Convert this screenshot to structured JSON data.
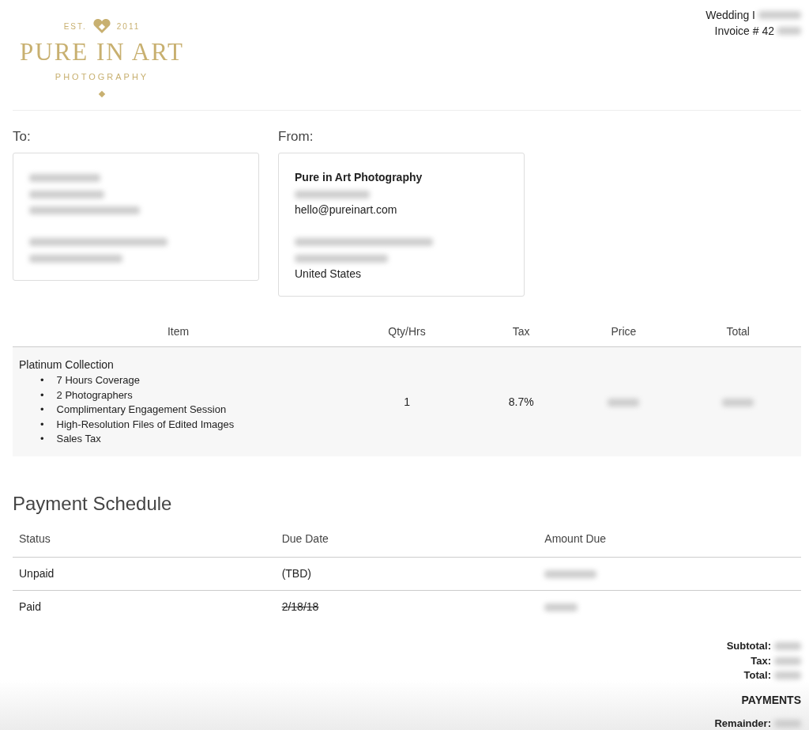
{
  "logo": {
    "est": "EST.",
    "year": "2011",
    "name": "PURE IN ART",
    "tagline": "PHOTOGRAPHY"
  },
  "header": {
    "event": "Wedding I",
    "invoice": "Invoice # 42"
  },
  "to": {
    "label": "To:",
    "lines": [
      {
        "kind": "redacted"
      },
      {
        "kind": "redacted"
      },
      {
        "kind": "redacted"
      },
      {
        "kind": "gap"
      },
      {
        "kind": "redacted"
      },
      {
        "kind": "redacted"
      }
    ]
  },
  "from": {
    "label": "From:",
    "lines": [
      {
        "kind": "name",
        "text": "Pure in Art Photography"
      },
      {
        "kind": "redacted"
      },
      {
        "kind": "text",
        "text": "hello@pureinart.com"
      },
      {
        "kind": "gap"
      },
      {
        "kind": "redacted"
      },
      {
        "kind": "redacted"
      },
      {
        "kind": "text",
        "text": "United States"
      }
    ]
  },
  "items": {
    "columns": [
      "Item",
      "Qty/Hrs",
      "Tax",
      "Price",
      "Total"
    ],
    "rows": [
      {
        "name": "Platinum Collection",
        "bullet": "•",
        "details": [
          "7 Hours Coverage",
          "2 Photographers",
          "Complimentary Engagement Session",
          "High-Resolution Files of Edited Images",
          "Sales Tax"
        ],
        "qty": "1",
        "tax": "8.7%"
      }
    ]
  },
  "payment_schedule": {
    "title": "Payment Schedule",
    "columns": [
      "Status",
      "Due Date",
      "Amount Due"
    ],
    "rows": [
      {
        "status": "Unpaid",
        "due": "(TBD)",
        "struck_through": false
      },
      {
        "status": "Paid",
        "due": "2/18/18",
        "struck_through": true
      }
    ]
  },
  "totals": {
    "lines": [
      "Subtotal:",
      "Tax:",
      "Total:"
    ],
    "payments": "PAYMENTS",
    "remainder": "Remainder:"
  }
}
